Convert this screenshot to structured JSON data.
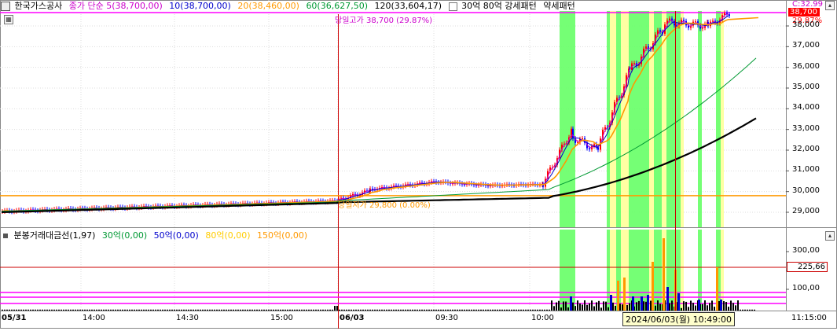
{
  "main_legend": {
    "title": "한국가스공사",
    "close_line": "종가 단순 5(38,700,00)",
    "ma10": "10(38,700,00)",
    "ma20": "20(38,460,00)",
    "ma60": "60(36,627,50)",
    "ma120": "120(33,604,17)",
    "pattern_strong": "30억 80억 강세패턴",
    "pattern_weak": "약세패턴"
  },
  "annotations": {
    "day_high": "당일고가 38,700 (29.87%)",
    "day_low": "당일저가 29,800 (0.00%)"
  },
  "price_tags": {
    "top": "C:32.99",
    "current": "38,700",
    "change": "29.87%"
  },
  "sub_legend": {
    "title": "분봉거래대금선(1,97)",
    "l30": "30억(0,00)",
    "l50": "50억(0,00)",
    "l80": "80억(0,00)",
    "l150": "150억(0,00)"
  },
  "sub_tag": "225,66",
  "y_axis": [
    "38,000",
    "37,000",
    "36,000",
    "35,000",
    "34,000",
    "33,000",
    "32,000",
    "31,000",
    "30,000",
    "29,000"
  ],
  "sub_axis": [
    "300,00",
    "200,00",
    "100,00"
  ],
  "time_axis": [
    "05/31",
    "14:00",
    "14:30",
    "15:00",
    "06/03",
    "09:30",
    "10:00",
    "11:15:00"
  ],
  "crosshair_label": "2024/06/03(월) 10:49:00",
  "colors": {
    "ma5": "#cc00cc",
    "ma10": "#0000cc",
    "ma20": "#ff9900",
    "ma60": "#009933",
    "ma120": "#000000",
    "band_green": "#66ff66",
    "band_yellow": "#ffff99",
    "magenta": "#ff00ff",
    "up": "#ff0000",
    "down": "#0000ff"
  }
}
